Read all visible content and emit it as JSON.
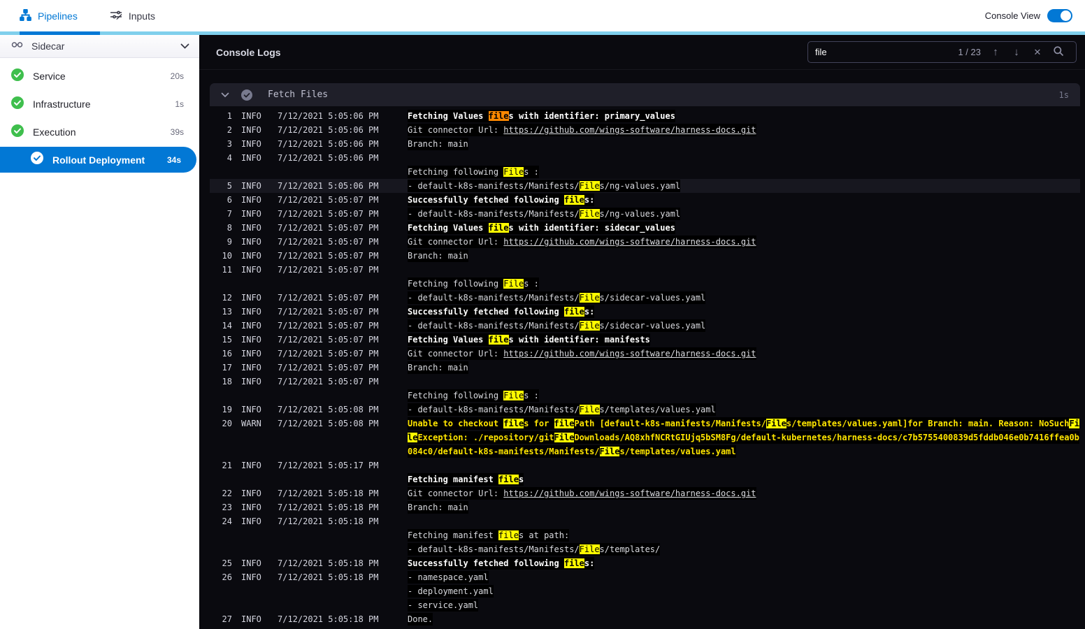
{
  "topbar": {
    "tabs": [
      {
        "label": "Pipelines",
        "active": true
      },
      {
        "label": "Inputs",
        "active": false
      }
    ],
    "console_view": {
      "label": "Console View",
      "enabled": true
    }
  },
  "sidebar": {
    "pipeline": {
      "name": "Sidecar"
    },
    "stages": [
      {
        "label": "Service",
        "duration": "20s",
        "status": "success",
        "selected": false
      },
      {
        "label": "Infrastructure",
        "duration": "1s",
        "status": "success",
        "selected": false
      },
      {
        "label": "Execution",
        "duration": "39s",
        "status": "success",
        "selected": false
      },
      {
        "label": "Rollout Deployment",
        "duration": "34s",
        "status": "success",
        "selected": true
      }
    ]
  },
  "console": {
    "title": "Console Logs",
    "search": {
      "value": "file",
      "counter": "1 / 23"
    },
    "section": {
      "title": "Fetch Files",
      "duration": "1s"
    },
    "link_url": "https://github.com/wings-software/harness-docs.git",
    "lines": [
      {
        "num": "1",
        "level": "INFO",
        "time": "7/12/2021 5:05:06 PM",
        "bold": true,
        "parts": [
          {
            "t": "p",
            "x": "Fetching Values "
          },
          {
            "t": "c",
            "x": "file"
          },
          {
            "t": "p",
            "x": "s with identifier: primary_values"
          }
        ]
      },
      {
        "num": "2",
        "level": "INFO",
        "time": "7/12/2021 5:05:06 PM",
        "parts": [
          {
            "t": "p",
            "x": "Git connector Url: "
          },
          {
            "t": "l",
            "x": "https://github.com/wings-software/harness-docs.git"
          }
        ]
      },
      {
        "num": "3",
        "level": "INFO",
        "time": "7/12/2021 5:05:06 PM",
        "parts": [
          {
            "t": "p",
            "x": "Branch: main"
          }
        ]
      },
      {
        "num": "4",
        "level": "INFO",
        "time": "7/12/2021 5:05:06 PM",
        "parts": []
      },
      {
        "parts": [
          {
            "t": "p",
            "x": "Fetching following "
          },
          {
            "t": "m",
            "x": "File"
          },
          {
            "t": "p",
            "x": "s :"
          }
        ]
      },
      {
        "num": "5",
        "level": "INFO",
        "time": "7/12/2021 5:05:06 PM",
        "row_highlight": true,
        "parts": [
          {
            "t": "p",
            "x": "- default-k8s-manifests/Manifests/"
          },
          {
            "t": "m",
            "x": "File"
          },
          {
            "t": "p",
            "x": "s/ng-values.yaml"
          }
        ]
      },
      {
        "num": "6",
        "level": "INFO",
        "time": "7/12/2021 5:05:07 PM",
        "bold": true,
        "parts": [
          {
            "t": "p",
            "x": "Successfully fetched following "
          },
          {
            "t": "m",
            "x": "file"
          },
          {
            "t": "p",
            "x": "s:"
          }
        ]
      },
      {
        "num": "7",
        "level": "INFO",
        "time": "7/12/2021 5:05:07 PM",
        "parts": [
          {
            "t": "p",
            "x": "- default-k8s-manifests/Manifests/"
          },
          {
            "t": "m",
            "x": "File"
          },
          {
            "t": "p",
            "x": "s/ng-values.yaml"
          }
        ]
      },
      {
        "num": "8",
        "level": "INFO",
        "time": "7/12/2021 5:05:07 PM",
        "bold": true,
        "parts": [
          {
            "t": "p",
            "x": "Fetching Values "
          },
          {
            "t": "m",
            "x": "file"
          },
          {
            "t": "p",
            "x": "s with identifier: sidecar_values"
          }
        ]
      },
      {
        "num": "9",
        "level": "INFO",
        "time": "7/12/2021 5:05:07 PM",
        "parts": [
          {
            "t": "p",
            "x": "Git connector Url: "
          },
          {
            "t": "l",
            "x": "https://github.com/wings-software/harness-docs.git"
          }
        ]
      },
      {
        "num": "10",
        "level": "INFO",
        "time": "7/12/2021 5:05:07 PM",
        "parts": [
          {
            "t": "p",
            "x": "Branch: main"
          }
        ]
      },
      {
        "num": "11",
        "level": "INFO",
        "time": "7/12/2021 5:05:07 PM",
        "parts": []
      },
      {
        "parts": [
          {
            "t": "p",
            "x": "Fetching following "
          },
          {
            "t": "m",
            "x": "File"
          },
          {
            "t": "p",
            "x": "s :"
          }
        ]
      },
      {
        "num": "12",
        "level": "INFO",
        "time": "7/12/2021 5:05:07 PM",
        "parts": [
          {
            "t": "p",
            "x": "- default-k8s-manifests/Manifests/"
          },
          {
            "t": "m",
            "x": "File"
          },
          {
            "t": "p",
            "x": "s/sidecar-values.yaml"
          }
        ]
      },
      {
        "num": "13",
        "level": "INFO",
        "time": "7/12/2021 5:05:07 PM",
        "bold": true,
        "parts": [
          {
            "t": "p",
            "x": "Successfully fetched following "
          },
          {
            "t": "m",
            "x": "file"
          },
          {
            "t": "p",
            "x": "s:"
          }
        ]
      },
      {
        "num": "14",
        "level": "INFO",
        "time": "7/12/2021 5:05:07 PM",
        "parts": [
          {
            "t": "p",
            "x": "- default-k8s-manifests/Manifests/"
          },
          {
            "t": "m",
            "x": "File"
          },
          {
            "t": "p",
            "x": "s/sidecar-values.yaml"
          }
        ]
      },
      {
        "num": "15",
        "level": "INFO",
        "time": "7/12/2021 5:05:07 PM",
        "bold": true,
        "parts": [
          {
            "t": "p",
            "x": "Fetching Values "
          },
          {
            "t": "m",
            "x": "file"
          },
          {
            "t": "p",
            "x": "s with identifier: manifests"
          }
        ]
      },
      {
        "num": "16",
        "level": "INFO",
        "time": "7/12/2021 5:05:07 PM",
        "parts": [
          {
            "t": "p",
            "x": "Git connector Url: "
          },
          {
            "t": "l",
            "x": "https://github.com/wings-software/harness-docs.git"
          }
        ]
      },
      {
        "num": "17",
        "level": "INFO",
        "time": "7/12/2021 5:05:07 PM",
        "parts": [
          {
            "t": "p",
            "x": "Branch: main"
          }
        ]
      },
      {
        "num": "18",
        "level": "INFO",
        "time": "7/12/2021 5:05:07 PM",
        "parts": []
      },
      {
        "parts": [
          {
            "t": "p",
            "x": "Fetching following "
          },
          {
            "t": "m",
            "x": "File"
          },
          {
            "t": "p",
            "x": "s :"
          }
        ]
      },
      {
        "num": "19",
        "level": "INFO",
        "time": "7/12/2021 5:05:08 PM",
        "parts": [
          {
            "t": "p",
            "x": "- default-k8s-manifests/Manifests/"
          },
          {
            "t": "m",
            "x": "File"
          },
          {
            "t": "p",
            "x": "s/templates/values.yaml"
          }
        ]
      },
      {
        "num": "20",
        "level": "WARN",
        "time": "7/12/2021 5:05:08 PM",
        "warn": true,
        "parts": [
          {
            "t": "p",
            "x": "Unable to checkout "
          },
          {
            "t": "m",
            "x": "file"
          },
          {
            "t": "p",
            "x": "s for "
          },
          {
            "t": "m",
            "x": "file"
          },
          {
            "t": "p",
            "x": "Path [default-k8s-manifests/Manifests/"
          },
          {
            "t": "m",
            "x": "File"
          },
          {
            "t": "p",
            "x": "s/templates/values.yaml]for Branch: main. Reason: NoSuch"
          },
          {
            "t": "m",
            "x": "File"
          },
          {
            "t": "p",
            "x": "Exception: ./repository/git"
          },
          {
            "t": "m",
            "x": "File"
          },
          {
            "t": "p",
            "x": "Downloads/AQ8xhfNCRtGIUjq5bSM8Fg/default-kubernetes/harness-docs/c7b5755400839d5fddb046e0b7416ffea0b084c0/default-k8s-manifests/Manifests/"
          },
          {
            "t": "m",
            "x": "File"
          },
          {
            "t": "p",
            "x": "s/templates/values.yaml"
          }
        ]
      },
      {
        "num": "21",
        "level": "INFO",
        "time": "7/12/2021 5:05:17 PM",
        "parts": []
      },
      {
        "bold": true,
        "parts": [
          {
            "t": "p",
            "x": "Fetching manifest "
          },
          {
            "t": "m",
            "x": "file"
          },
          {
            "t": "p",
            "x": "s"
          }
        ]
      },
      {
        "num": "22",
        "level": "INFO",
        "time": "7/12/2021 5:05:18 PM",
        "parts": [
          {
            "t": "p",
            "x": "Git connector Url: "
          },
          {
            "t": "l",
            "x": "https://github.com/wings-software/harness-docs.git"
          }
        ]
      },
      {
        "num": "23",
        "level": "INFO",
        "time": "7/12/2021 5:05:18 PM",
        "parts": [
          {
            "t": "p",
            "x": "Branch: main"
          }
        ]
      },
      {
        "num": "24",
        "level": "INFO",
        "time": "7/12/2021 5:05:18 PM",
        "parts": []
      },
      {
        "parts": [
          {
            "t": "p",
            "x": "Fetching manifest "
          },
          {
            "t": "m",
            "x": "file"
          },
          {
            "t": "p",
            "x": "s at path:"
          }
        ]
      },
      {
        "parts": [
          {
            "t": "p",
            "x": "- default-k8s-manifests/Manifests/"
          },
          {
            "t": "m",
            "x": "File"
          },
          {
            "t": "p",
            "x": "s/templates/"
          }
        ]
      },
      {
        "num": "25",
        "level": "INFO",
        "time": "7/12/2021 5:05:18 PM",
        "bold": true,
        "parts": [
          {
            "t": "p",
            "x": "Successfully fetched following "
          },
          {
            "t": "m",
            "x": "file"
          },
          {
            "t": "p",
            "x": "s:"
          }
        ]
      },
      {
        "num": "26",
        "level": "INFO",
        "time": "7/12/2021 5:05:18 PM",
        "parts": [
          {
            "t": "p",
            "x": "- namespace.yaml"
          }
        ]
      },
      {
        "parts": [
          {
            "t": "p",
            "x": "- deployment.yaml"
          }
        ]
      },
      {
        "parts": [
          {
            "t": "p",
            "x": "- service.yaml"
          }
        ]
      },
      {
        "num": "27",
        "level": "INFO",
        "time": "7/12/2021 5:05:18 PM",
        "parts": [
          {
            "t": "p",
            "x": "Done."
          }
        ]
      }
    ]
  },
  "colors": {
    "accent_blue": "#0278d5",
    "accent_light_blue": "#7fcfec",
    "success_green": "#3fbf4d",
    "match_highlight": "#fffb00",
    "current_match_highlight": "#ff8800",
    "warn_text": "#ffe500"
  }
}
